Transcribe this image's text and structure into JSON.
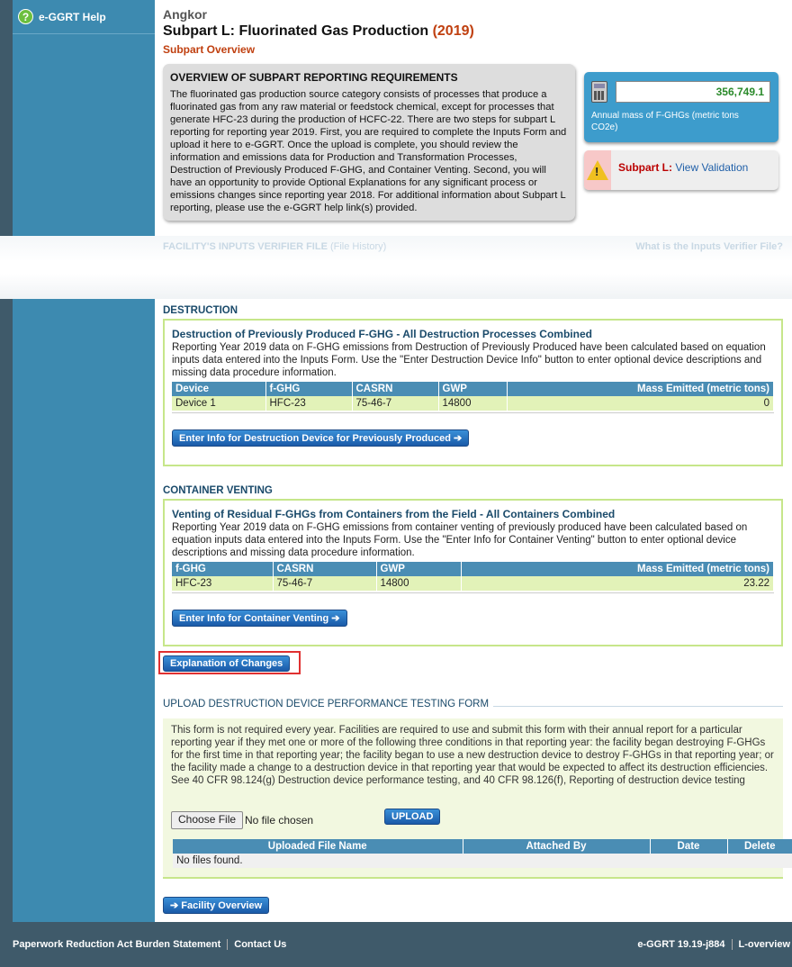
{
  "sidebar": {
    "help_label": "e-GGRT Help"
  },
  "header": {
    "facility": "Angkor",
    "title": "Subpart L: Fluorinated Gas Production",
    "year": "(2019)",
    "subtitle": "Subpart Overview"
  },
  "overview": {
    "heading": "OVERVIEW OF SUBPART REPORTING REQUIREMENTS",
    "text": "The fluorinated gas production source category consists of processes that produce a fluorinated gas from any raw material or feedstock chemical, except for processes that generate HFC-23 during the production of HCFC-22. There are two steps for subpart L reporting for reporting year 2019. First, you are required to complete the Inputs Form and upload it here to e-GGRT. Once the upload is complete, you should review the information and emissions data for Production and Transformation Processes, Destruction of Previously Produced F-GHG, and Container Venting. Second, you will have an opportunity to provide Optional Explanations for any significant process or emissions changes since reporting year 2018. For additional information about Subpart L reporting, please use the e-GGRT help link(s) provided."
  },
  "mass": {
    "value": "356,749.1",
    "label": "Annual mass of F-GHGs (metric tons CO2e)"
  },
  "validation": {
    "label": "Subpart L:",
    "link": "View Validation"
  },
  "inputs_verifier": {
    "title": "FACILITY'S INPUTS VERIFIER FILE",
    "history": "(File History)",
    "link": "What is the Inputs Verifier File?"
  },
  "destruction": {
    "section": "DESTRUCTION",
    "title": "Destruction of Previously Produced F-GHG - All Destruction Processes Combined",
    "text": "Reporting Year 2019 data on F-GHG emissions from Destruction of Previously Produced have been calculated based on equation inputs data entered into the Inputs Form. Use the \"Enter Destruction Device Info\" button to enter optional device descriptions and missing data procedure information.",
    "columns": [
      "Device",
      "f-GHG",
      "CASRN",
      "GWP",
      "Mass Emitted (metric tons)"
    ],
    "rows": [
      [
        "Device 1",
        "HFC-23",
        "75-46-7",
        "14800",
        "0"
      ]
    ],
    "button": "Enter Info for Destruction Device for Previously Produced"
  },
  "container": {
    "section": "CONTAINER VENTING",
    "title": "Venting of Residual F-GHGs from Containers from the Field - All Containers Combined",
    "text": "Reporting Year 2019 data on F-GHG emissions from container venting of previously produced have been calculated based on equation inputs data entered into the Inputs Form. Use the \"Enter Info for Container Venting\" button to enter optional device descriptions and missing data procedure information.",
    "columns": [
      "f-GHG",
      "CASRN",
      "GWP",
      "Mass Emitted (metric tons)"
    ],
    "rows": [
      [
        "HFC-23",
        "75-46-7",
        "14800",
        "23.22"
      ]
    ],
    "button": "Enter Info for Container Venting"
  },
  "explanation_button": "Explanation of Changes",
  "upload": {
    "heading": "UPLOAD DESTRUCTION DEVICE PERFORMANCE TESTING FORM",
    "text": "This form is not required every year. Facilities are required to use and submit this form with their annual report for a particular reporting year if they met one or more of the following three conditions in that reporting year: the facility began destroying F-GHGs for the first time in that reporting year; the facility began to use a new destruction device to destroy F-GHGs in that reporting year; or the facility made a change to a destruction device in that reporting year that would be expected to affect its destruction efficiencies. See 40 CFR 98.124(g) Destruction device performance testing, and 40 CFR 98.126(f), Reporting of destruction device testing",
    "choose_label": "Choose File",
    "no_file": "No file chosen",
    "upload_button": "UPLOAD",
    "columns": [
      "Uploaded File Name",
      "Attached By",
      "Date",
      "Delete"
    ],
    "empty": "No files found."
  },
  "facility_overview_button": "Facility Overview",
  "footer": {
    "paperwork": "Paperwork Reduction Act Burden Statement",
    "contact": "Contact Us",
    "version": "e-GGRT 19.19-j884",
    "page_id": "L-overview"
  }
}
